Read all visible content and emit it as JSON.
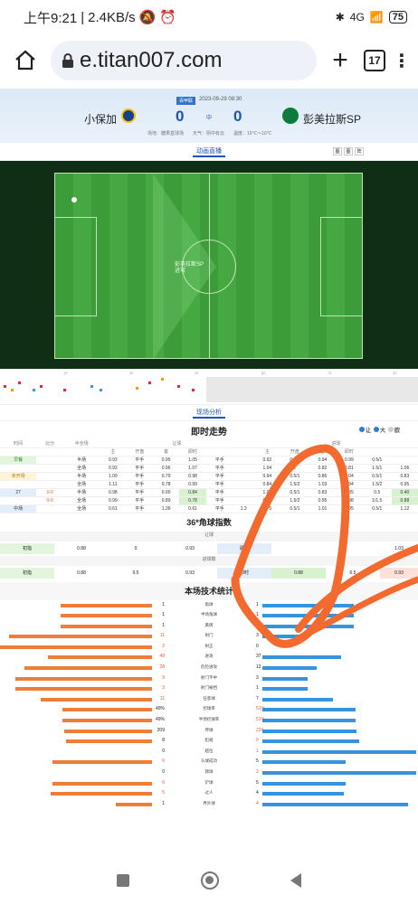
{
  "statusbar": {
    "time": "上午9:21",
    "speed": "2.4KB/s",
    "net": "4G",
    "battery": "75"
  },
  "browser": {
    "url": "e.titan007.com",
    "tabs": "17"
  },
  "match": {
    "tag": "百甲联",
    "datetime": "2023-09-29 08:30",
    "home": "小保加",
    "away": "彭美拉斯SP",
    "home_score": "0",
    "away_score": "0",
    "mid": "中",
    "venue": "场地：糖果盒球场",
    "weather": "天气：阴中有云",
    "temp": "温度：19℃～16℃"
  },
  "live_tab": {
    "label": "动画直播",
    "icons": [
      "图",
      "图",
      "阵"
    ]
  },
  "pitch": {
    "attack_team": "彭美拉斯SP",
    "attack_state": "进攻"
  },
  "timeline": {
    "ticks": [
      "15",
      "30",
      "45",
      "HT",
      "60",
      "75",
      "90"
    ]
  },
  "analysis_tab": "现场分析",
  "trend": {
    "title": "即时走势",
    "legend": [
      "让",
      "大",
      "欧"
    ],
    "head": [
      "时间",
      "比分",
      "半全场",
      "让球",
      "",
      "",
      "",
      "",
      "",
      "进球",
      "",
      "",
      ""
    ],
    "sub": [
      "",
      "",
      "",
      "",
      "主",
      "开盘",
      "客",
      "即时",
      "主",
      "开盘",
      "客",
      "即时"
    ],
    "rows": [
      {
        "time": "",
        "score": "",
        "grp": "早餐",
        "half": "半场",
        "v": [
          "0.93",
          "平手",
          "0.95",
          "1.05",
          "平手",
          "",
          "0.92",
          "0.5/1",
          "0.94",
          "0.99",
          "0.5/1",
          ""
        ]
      },
      {
        "time": "",
        "score": "",
        "grp": "",
        "half": "全场",
        "v": [
          "0.92",
          "平手",
          "0.96",
          "1.07",
          "平手",
          "",
          "1.04",
          "2",
          "0.82",
          "0.81",
          "1.5/1",
          "1.06"
        ]
      },
      {
        "time": "",
        "score": "",
        "grp": "未开场",
        "half": "半场",
        "v": [
          "1.09",
          "平手",
          "0.79",
          "0.98",
          "平手",
          "",
          "0.94",
          "0.5/1",
          "0.86",
          "1.04",
          "0.5/1",
          "0.83"
        ]
      },
      {
        "time": "",
        "score": "",
        "grp": "",
        "half": "全场",
        "v": [
          "1.11",
          "平手",
          "0.78",
          "0.99",
          "平手",
          "",
          "0.84",
          "1.5/2",
          "1.03",
          "0.94",
          "1.5/2",
          "0.95"
        ]
      },
      {
        "time": "27",
        "score": "0-0",
        "grp": "",
        "half": "半场",
        "v": [
          "0.98",
          "平手",
          "0.90",
          "0.84",
          "平手",
          "",
          "1.03",
          "0.5/1",
          "0.83",
          "0.85",
          "0.5",
          "0.40"
        ]
      },
      {
        "time": "",
        "score": "0-0",
        "grp": "",
        "half": "全场",
        "v": [
          "0.99",
          "平手",
          "0.89",
          "0.78",
          "平手",
          "",
          "0.91",
          "1.5/2",
          "0.95",
          "0.98",
          "1/1.5",
          "0.88"
        ]
      },
      {
        "time": "中场",
        "score": "",
        "grp": "",
        "half": "全场",
        "v": [
          "0.61",
          "平手",
          "1.36",
          "0.61",
          "平手",
          "1.3",
          "0.75",
          "0.5/1",
          "1.01",
          "0.95",
          "0.5/1",
          "1.12"
        ]
      }
    ]
  },
  "corner": {
    "title": "36*角球指数",
    "sub1": "让球",
    "sub2": "进球数",
    "row1": {
      "label": "初指",
      "v": [
        "0.88",
        "0",
        "0.93",
        "即时",
        "",
        "",
        "1.03"
      ]
    },
    "row2": {
      "label": "初指",
      "v": [
        "0.88",
        "9.5",
        "0.93",
        "即时",
        "0.88",
        "6.5",
        "0.93"
      ]
    }
  },
  "stats": {
    "title": "本场技术统计",
    "rows": [
      {
        "label": "角球",
        "home": "1",
        "away": "1",
        "h": 1,
        "a": 1
      },
      {
        "label": "半场角球",
        "home": "1",
        "away": "1",
        "h": 1,
        "a": 1
      },
      {
        "label": "黄牌",
        "home": "1",
        "away": "1",
        "h": 1,
        "a": 1
      },
      {
        "label": "射门",
        "home": "11",
        "away": "3",
        "h": 11,
        "a": 3
      },
      {
        "label": "射正",
        "home": "2",
        "away": "0",
        "h": 2,
        "a": 0
      },
      {
        "label": "进攻",
        "home": "49",
        "away": "37",
        "h": 49,
        "a": 37
      },
      {
        "label": "危险进攻",
        "home": "28",
        "away": "12",
        "h": 28,
        "a": 12
      },
      {
        "label": "射门不中",
        "home": "9",
        "away": "3",
        "h": 9,
        "a": 3
      },
      {
        "label": "射门被挡",
        "home": "3",
        "away": "1",
        "h": 3,
        "a": 1
      },
      {
        "label": "任意球",
        "home": "11",
        "away": "7",
        "h": 11,
        "a": 7
      },
      {
        "label": "控球率",
        "home": "49%",
        "away": "51%",
        "h": 49,
        "a": 51
      },
      {
        "label": "半场控球率",
        "home": "49%",
        "away": "51%",
        "h": 49,
        "a": 51
      },
      {
        "label": "传球",
        "home": "209",
        "away": "224",
        "h": 209,
        "a": 224
      },
      {
        "label": "犯规",
        "home": "8",
        "away": "9",
        "h": 8,
        "a": 9
      },
      {
        "label": "越位",
        "home": "0",
        "away": "1",
        "h": 0,
        "a": 1
      },
      {
        "label": "头球成功",
        "home": "6",
        "away": "5",
        "h": 6,
        "a": 5
      },
      {
        "label": "救球",
        "home": "0",
        "away": "2",
        "h": 0,
        "a": 2
      },
      {
        "label": "铲球",
        "home": "6",
        "away": "5",
        "h": 6,
        "a": 5
      },
      {
        "label": "过人",
        "home": "5",
        "away": "4",
        "h": 5,
        "a": 4
      },
      {
        "label": "界外球",
        "home": "1",
        "away": "4",
        "h": 1,
        "a": 4
      }
    ]
  },
  "colors": {
    "home_bar": "#f07c3a",
    "away_bar": "#3593e0",
    "accent": "#1a56b3"
  }
}
